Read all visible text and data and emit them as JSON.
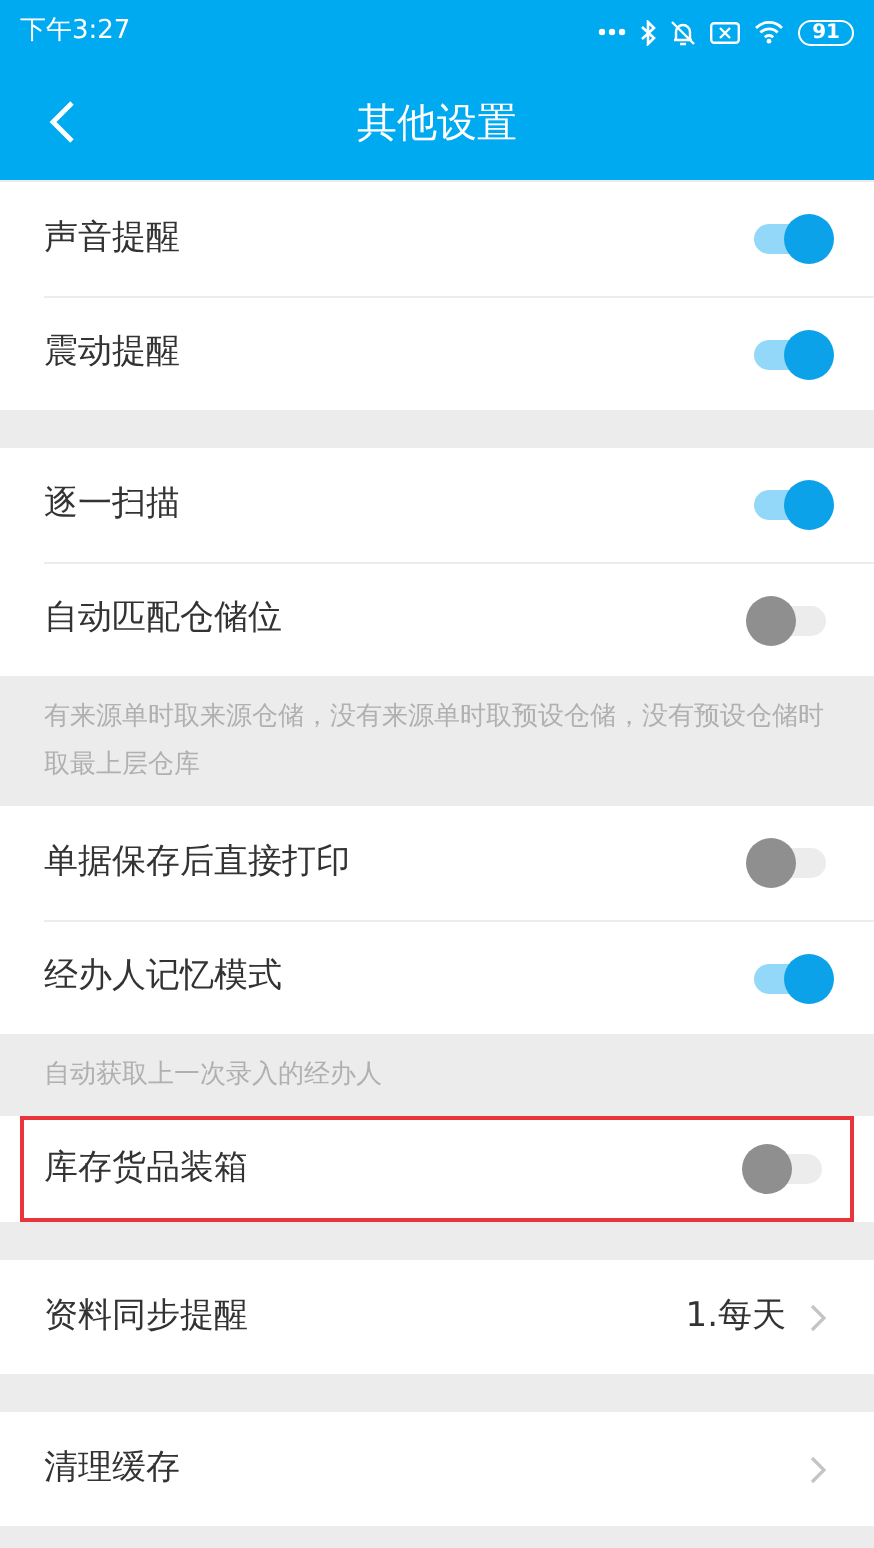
{
  "status_bar": {
    "time": "下午3:27",
    "battery": "91"
  },
  "header": {
    "title": "其他设置"
  },
  "groups": [
    {
      "items": [
        {
          "kind": "toggle",
          "label": "声音提醒",
          "on": true
        },
        {
          "kind": "toggle",
          "label": "震动提醒",
          "on": true
        }
      ]
    },
    {
      "items": [
        {
          "kind": "toggle",
          "label": "逐一扫描",
          "on": true
        },
        {
          "kind": "toggle",
          "label": "自动匹配仓储位",
          "on": false
        }
      ],
      "note": "有来源单时取来源仓储，没有来源单时取预设仓储，没有预设仓储时取最上层仓库"
    },
    {
      "items": [
        {
          "kind": "toggle",
          "label": "单据保存后直接打印",
          "on": false
        },
        {
          "kind": "toggle",
          "label": "经办人记忆模式",
          "on": true
        }
      ],
      "note": "自动获取上一次录入的经办人"
    },
    {
      "highlighted": true,
      "items": [
        {
          "kind": "toggle",
          "label": "库存货品装箱",
          "on": false
        }
      ]
    },
    {
      "items": [
        {
          "kind": "link",
          "label": "资料同步提醒",
          "value": "1.每天"
        }
      ]
    },
    {
      "items": [
        {
          "kind": "link",
          "label": "清理缓存"
        }
      ]
    }
  ]
}
